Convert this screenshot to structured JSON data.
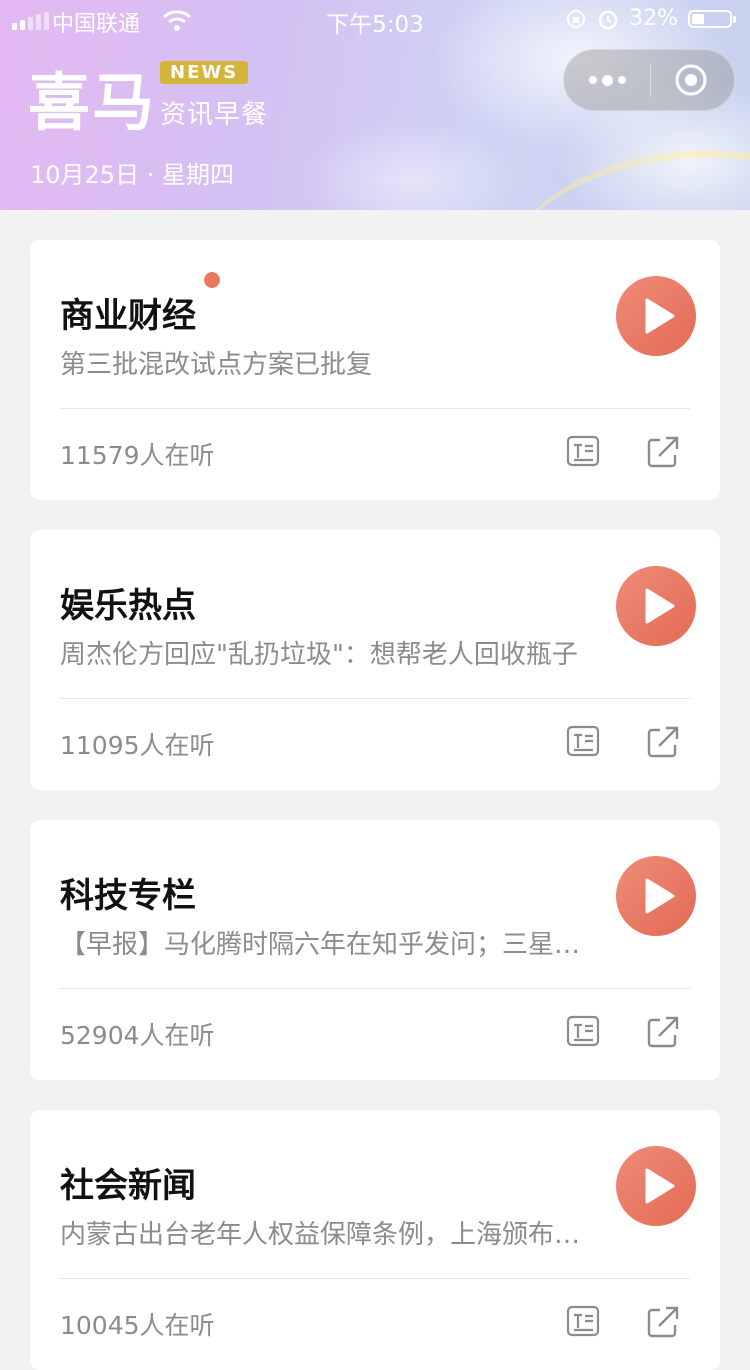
{
  "status_bar": {
    "carrier": "中国联通",
    "time": "下午5:03",
    "battery": "32%",
    "battery_level": 0.32
  },
  "header": {
    "logo_text": "喜马",
    "badge": "NEWS",
    "subtitle": "资讯早餐",
    "date": "10月25日 · 星期四",
    "accent_color": "#d4b53a"
  },
  "capsule": {
    "more_icon": "more-dots-icon",
    "close_icon": "target-circle-icon"
  },
  "cards": [
    {
      "title": "商业财经",
      "subtitle": "第三批混改试点方案已批复",
      "listeners": "11579人在听",
      "has_dot": true
    },
    {
      "title": "娱乐热点",
      "subtitle": "周杰伦方回应\"乱扔垃圾\"：想帮老人回收瓶子",
      "listeners": "11095人在听",
      "has_dot": false
    },
    {
      "title": "科技专栏",
      "subtitle": "【早报】马化腾时隔六年在知乎发问；三星新机曝光",
      "listeners": "52904人在听",
      "has_dot": false
    },
    {
      "title": "社会新闻",
      "subtitle": "内蒙古出台老年人权益保障条例，上海颁布新规",
      "listeners": "10045人在听",
      "has_dot": false
    }
  ],
  "colors": {
    "play_button": "#e97561",
    "unread_dot": "#ea7a5e",
    "page_bg": "#f2f2f2"
  }
}
